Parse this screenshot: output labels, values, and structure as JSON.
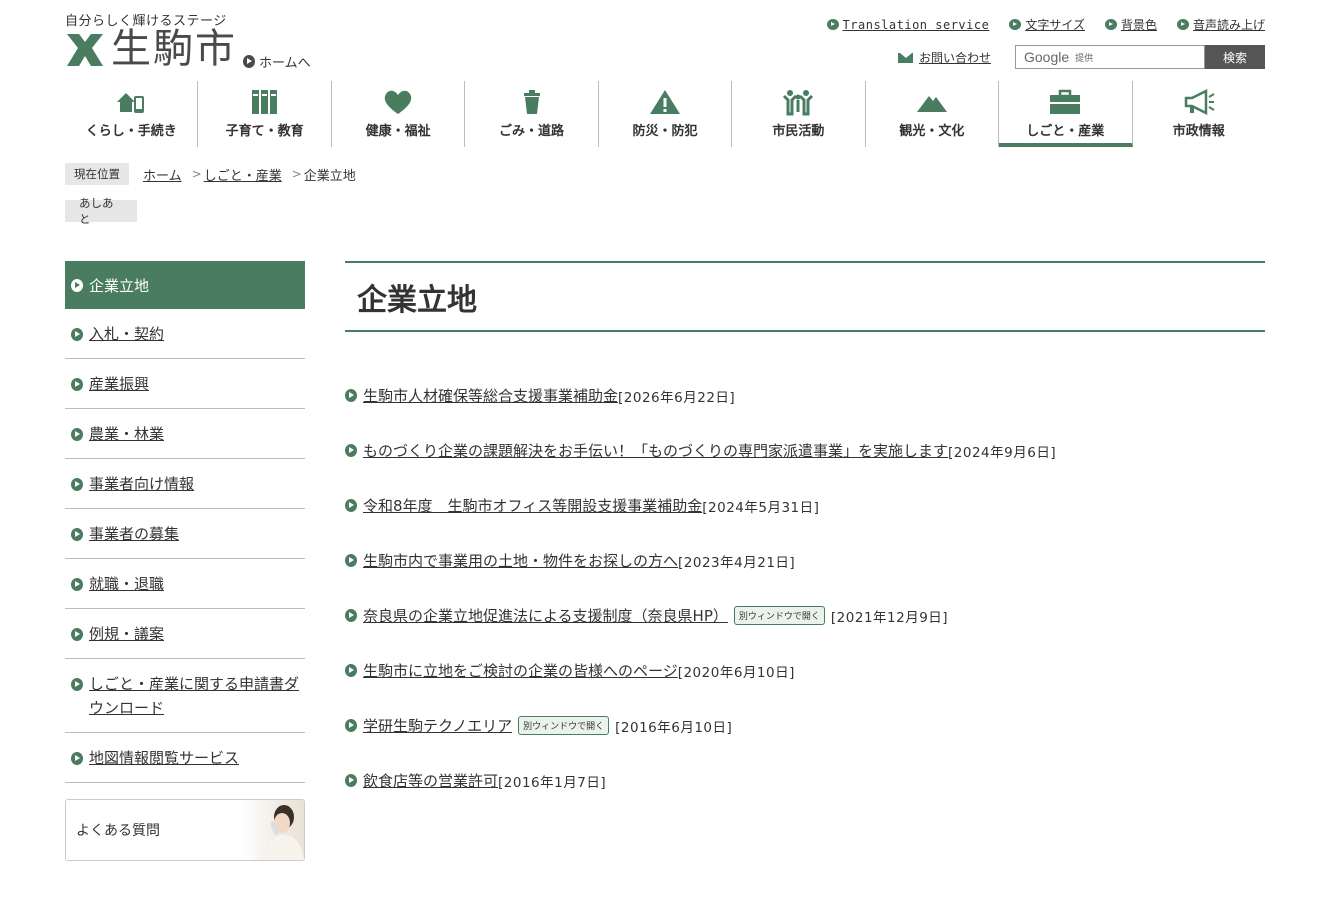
{
  "header": {
    "tagline": "自分らしく輝けるステージ",
    "logo_text": "生駒市",
    "home_link": "ホームへ",
    "util_links": [
      "Translation service",
      "文字サイズ",
      "背景色",
      "音声読み上げ"
    ],
    "contact": "お問い合わせ",
    "search": {
      "google": "Google",
      "provided": "提供",
      "button": "検索"
    }
  },
  "gnav": [
    {
      "label": "くらし・手続き",
      "icon": "house-phone-icon"
    },
    {
      "label": "子育て・教育",
      "icon": "books-icon"
    },
    {
      "label": "健康・福祉",
      "icon": "heart-icon"
    },
    {
      "label": "ごみ・道路",
      "icon": "trash-can-icon"
    },
    {
      "label": "防災・防犯",
      "icon": "warning-icon"
    },
    {
      "label": "市民活動",
      "icon": "people-icon"
    },
    {
      "label": "観光・文化",
      "icon": "mountain-icon"
    },
    {
      "label": "しごと・産業",
      "icon": "briefcase-icon",
      "active": true
    },
    {
      "label": "市政情報",
      "icon": "megaphone-icon"
    }
  ],
  "breadcrumb": {
    "tag": "現在位置",
    "home": "ホーム",
    "parent": "しごと・産業",
    "current": "企業立地",
    "sep": ">"
  },
  "footprint": "あしあと",
  "side": {
    "head": "企業立地",
    "items": [
      "入札・契約",
      "産業振興",
      "農業・林業",
      "事業者向け情報",
      "事業者の募集",
      "就職・退職",
      "例規・議案",
      "しごと・産業に関する申請書ダウンロード",
      "地図情報閲覧サービス"
    ],
    "faq": "よくある質問"
  },
  "main": {
    "title": "企業立地",
    "ext_badge": "別ウィンドウで開く",
    "news": [
      {
        "title": "生駒市人材確保等総合支援事業補助金",
        "date": "[2026年6月22日]",
        "external": false
      },
      {
        "title": "ものづくり企業の課題解決をお手伝い！「ものづくりの専門家派遣事業」を実施します",
        "date": "[2024年9月6日]",
        "external": false
      },
      {
        "title": "令和8年度　生駒市オフィス等開設支援事業補助金",
        "date": "[2024年5月31日]",
        "external": false
      },
      {
        "title": "生駒市内で事業用の土地・物件をお探しの方へ",
        "date": "[2023年4月21日]",
        "external": false
      },
      {
        "title": "奈良県の企業立地促進法による支援制度（奈良県HP）",
        "date": "[2021年12月9日]",
        "external": true
      },
      {
        "title": "生駒市に立地をご検討の企業の皆様へのページ",
        "date": "[2020年6月10日]",
        "external": false
      },
      {
        "title": "学研生駒テクノエリア",
        "date": "[2016年6月10日]",
        "external": true
      },
      {
        "title": "飲食店等の営業許可",
        "date": "[2016年1月7日]",
        "external": false
      }
    ]
  },
  "colors": {
    "accent": "#4a7c5f",
    "dark": "#4a4a4a"
  }
}
